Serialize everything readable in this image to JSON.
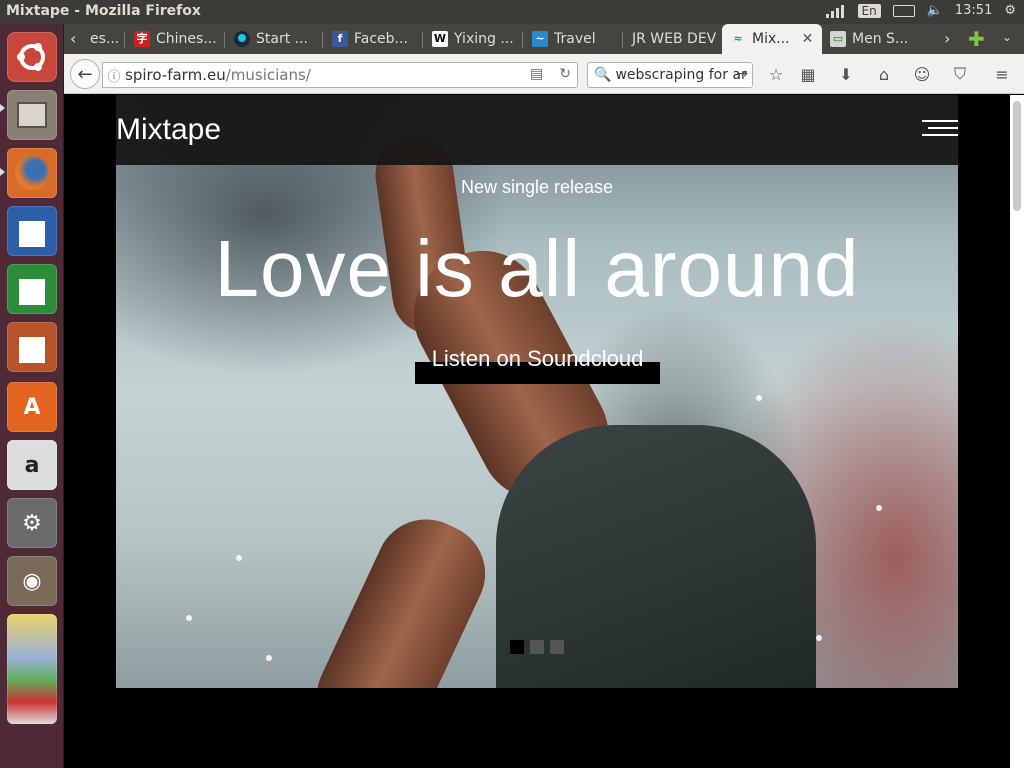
{
  "window": {
    "title": "Mixtape - Mozilla Firefox"
  },
  "tray": {
    "lang": "En",
    "time": "13:51"
  },
  "tabs": [
    {
      "label": "es...",
      "favicon": "generic"
    },
    {
      "label": "Chines...",
      "favicon": "chinese"
    },
    {
      "label": "Start ...",
      "favicon": "start"
    },
    {
      "label": "Faceb...",
      "favicon": "facebook"
    },
    {
      "label": "Yixing ...",
      "favicon": "wikipedia"
    },
    {
      "label": "Travel",
      "favicon": "travel"
    },
    {
      "label": "JR WEB DEV",
      "favicon": "none"
    },
    {
      "label": "Mix...",
      "favicon": "mixtape"
    },
    {
      "label": "Men S...",
      "favicon": "men"
    }
  ],
  "nav": {
    "url_host": "spiro-farm.eu",
    "url_path": "/musicians/",
    "search_value": "webscraping for ar"
  },
  "page": {
    "logo": "Mixtape",
    "subtitle": "New single release",
    "headline": "Love is all around",
    "cta": "Listen on Soundcloud"
  },
  "colors": {
    "launcher_bg": "#4d2a35",
    "topbar_bg": "#3c3b37"
  }
}
